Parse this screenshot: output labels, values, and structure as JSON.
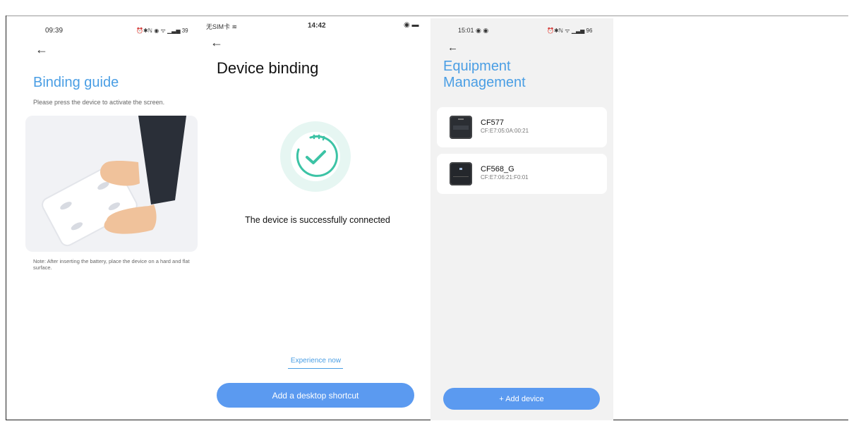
{
  "panel1": {
    "status_time": "09:39",
    "status_icons": "⏰✱ℕ ◉ ᯤ ▁▃▅ 39",
    "title": "Binding guide",
    "description": "Please press the device to activate the screen.",
    "note": "Note: After inserting the battery, place the device on a hard and flat surface."
  },
  "panel2": {
    "status_carrier": "无SIM卡 ≋",
    "status_time": "14:42",
    "status_icons": "◉ ▬",
    "title": "Device binding",
    "message": "The device is successfully connected",
    "experience_link": "Experience now",
    "shortcut_button": "Add a desktop shortcut"
  },
  "panel3": {
    "status_time": "15:01 ◉ ◉",
    "status_icons": "⏰✱ℕ ᯤ ▁▃▅ 96",
    "title_line1": "Equipment",
    "title_line2": "Management",
    "devices": [
      {
        "name": "CF577",
        "mac": "CF:E7:05:0A:00:21"
      },
      {
        "name": "CF568_G",
        "mac": "CF:E7:06:21:F0:01"
      }
    ],
    "add_button": "+ Add device"
  },
  "colors": {
    "accent": "#4a9ee4",
    "button": "#5b9af0",
    "success": "#3cc3a5"
  }
}
